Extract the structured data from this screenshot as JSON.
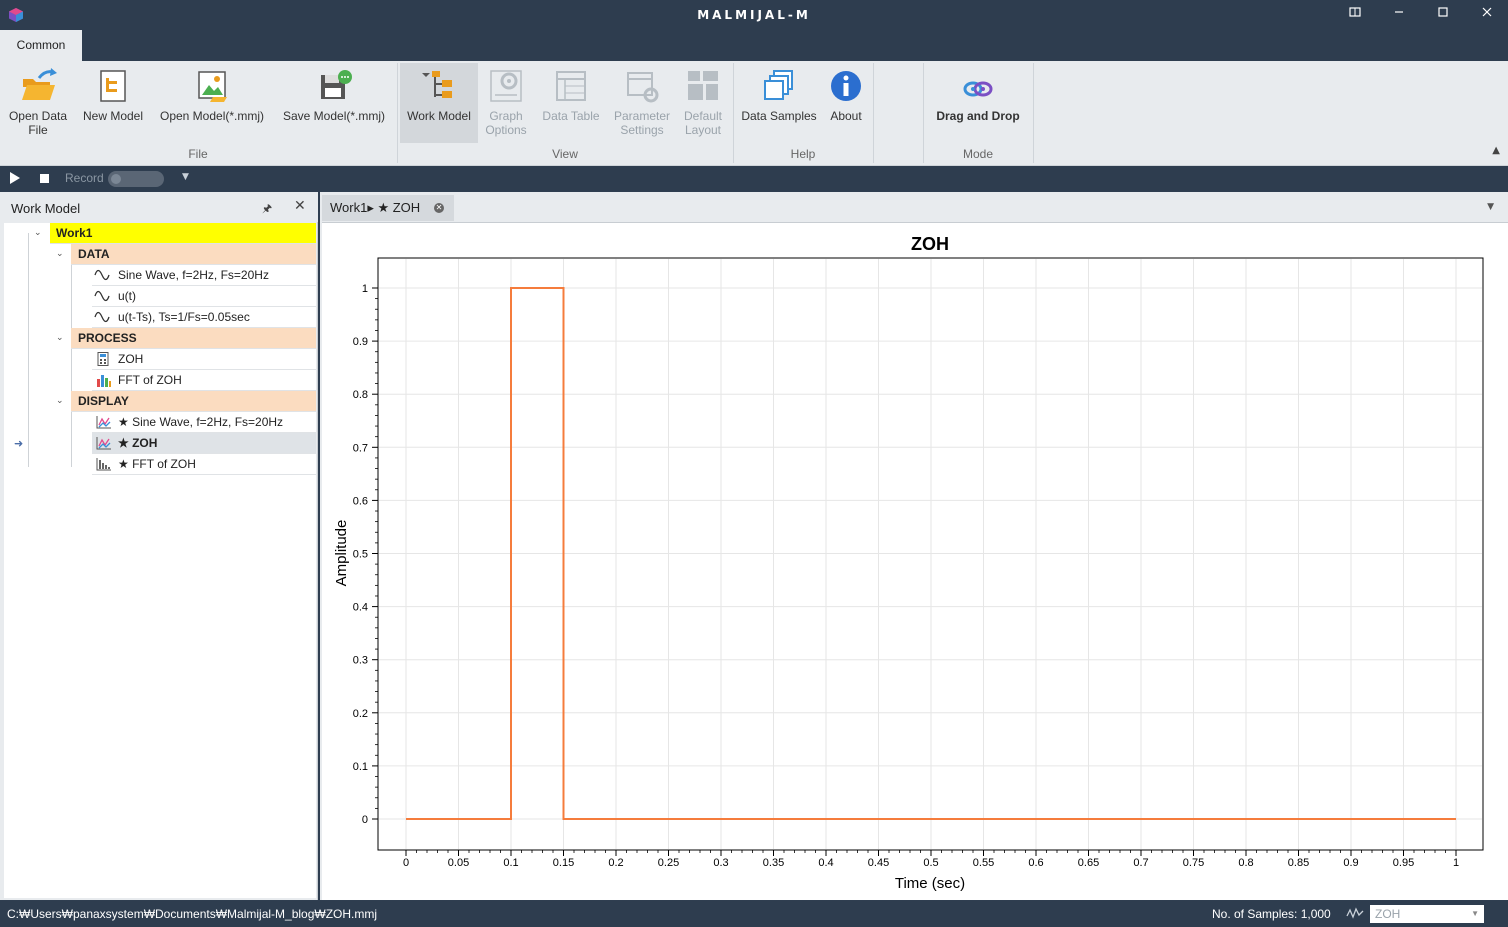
{
  "window": {
    "title": "MALMIJAL-M",
    "controls": [
      "restore-layout-icon",
      "minimize-icon",
      "maximize-icon",
      "close-icon"
    ]
  },
  "ribbon": {
    "tab": "Common",
    "groups": {
      "file": "File",
      "view": "View",
      "help": "Help",
      "mode": "Mode"
    },
    "buttons": {
      "open_data_file": "Open Data\nFile",
      "new_model": "New Model",
      "open_model": "Open Model(*.mmj)",
      "save_model": "Save Model(*.mmj)",
      "work_model": "Work Model",
      "graph_options": "Graph\nOptions",
      "data_table": "Data Table",
      "parameter_settings": "Parameter\nSettings",
      "default_layout": "Default\nLayout",
      "data_samples": "Data Samples",
      "about": "About",
      "drag_and_drop": "Drag and Drop"
    }
  },
  "recordbar": {
    "label": "Record"
  },
  "work_model_panel": {
    "title": "Work Model",
    "root": "Work1",
    "categories": {
      "data": "DATA",
      "process": "PROCESS",
      "display": "DISPLAY"
    },
    "data_items": [
      "Sine Wave, f=2Hz, Fs=20Hz",
      "u(t)",
      "u(t-Ts), Ts=1/Fs=0.05sec"
    ],
    "process_items": [
      "ZOH",
      "FFT of ZOH"
    ],
    "display_items": [
      "★ Sine Wave, f=2Hz, Fs=20Hz",
      "★ ZOH",
      "★ FFT of ZOH"
    ]
  },
  "document": {
    "tab_label": "Work1▸ ★ ZOH"
  },
  "chart_data": {
    "type": "line",
    "title": "ZOH",
    "xlabel": "Time (sec)",
    "ylabel": "Amplitude",
    "xlim": [
      0,
      1
    ],
    "ylim": [
      0,
      1
    ],
    "xticks": [
      "0",
      "0.05",
      "0.1",
      "0.15",
      "0.2",
      "0.25",
      "0.3",
      "0.35",
      "0.4",
      "0.45",
      "0.5",
      "0.55",
      "0.6",
      "0.65",
      "0.7",
      "0.75",
      "0.8",
      "0.85",
      "0.9",
      "0.95",
      "1"
    ],
    "yticks": [
      "0",
      "0.1",
      "0.2",
      "0.3",
      "0.4",
      "0.5",
      "0.6",
      "0.7",
      "0.8",
      "0.9",
      "1"
    ],
    "grid": true,
    "color": "#f57c3c",
    "series": [
      {
        "x": [
          0,
          0.1,
          0.1,
          0.15,
          0.15,
          1
        ],
        "y": [
          0,
          0,
          1,
          1,
          0,
          0
        ]
      }
    ]
  },
  "statusbar": {
    "path": "C:₩Users₩panaxsystem₩Documents₩Malmijal-M_blog₩ZOH.mmj",
    "samples": "No. of Samples: 1,000",
    "selected_series": "ZOH"
  },
  "colors": {
    "chrome": "#2e3d4f",
    "root_highlight": "#ffff00",
    "category_highlight": "#fbdcc0",
    "plot_line": "#f57c3c"
  }
}
